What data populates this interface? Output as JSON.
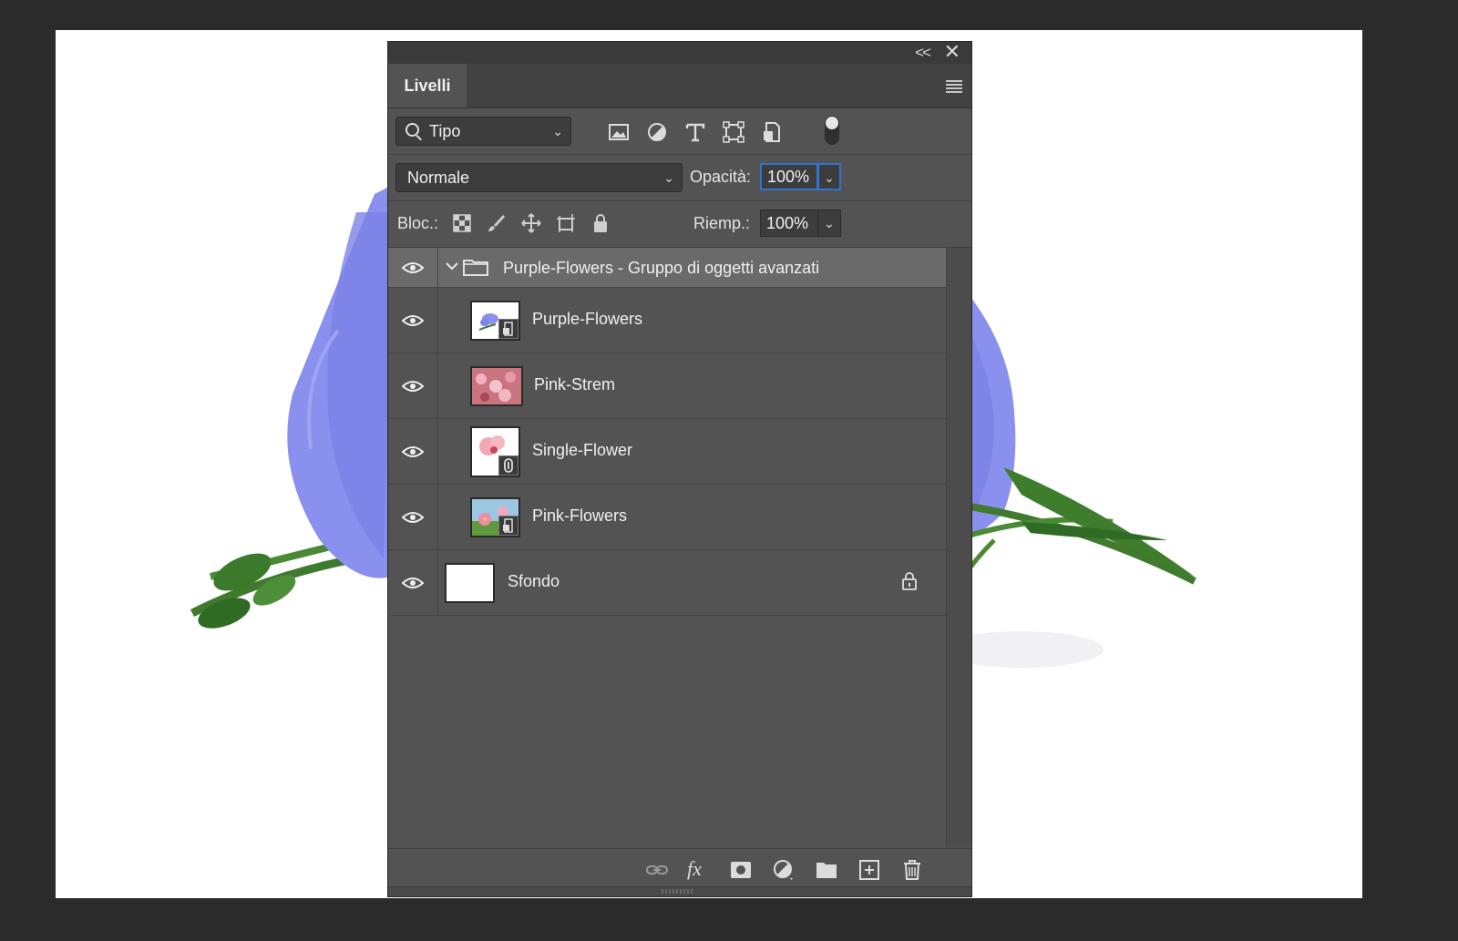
{
  "panel": {
    "tab_label": "Livelli",
    "collapse_label": "<<",
    "close_label": "✕"
  },
  "filter": {
    "kind_label": "Tipo",
    "icons": [
      "image-filter-icon",
      "adjustment-filter-icon",
      "type-filter-icon",
      "shape-filter-icon",
      "smart-object-filter-icon",
      "filter-toggle"
    ]
  },
  "blend": {
    "mode": "Normale",
    "opacity_label": "Opacità:",
    "opacity_value": "100%"
  },
  "lock": {
    "label": "Bloc.:",
    "fill_label": "Riemp.:",
    "fill_value": "100%",
    "icons": [
      "lock-transparent-pixels-icon",
      "lock-image-pixels-icon",
      "lock-position-icon",
      "lock-artboard-icon",
      "lock-all-icon"
    ]
  },
  "layers": [
    {
      "name": "Purple-Flowers - Gruppo di oggetti avanzati",
      "type": "group",
      "visible": true,
      "expanded": true
    },
    {
      "name": "Purple-Flowers",
      "type": "smart-object",
      "visible": true
    },
    {
      "name": "Pink-Strem",
      "type": "pixel",
      "visible": true
    },
    {
      "name": "Single-Flower",
      "type": "smart-object-linked",
      "visible": true
    },
    {
      "name": "Pink-Flowers",
      "type": "smart-object",
      "visible": true
    },
    {
      "name": "Sfondo",
      "type": "background",
      "visible": true,
      "locked": true
    }
  ],
  "footer_icons": [
    "link-layers-icon",
    "fx-icon",
    "layer-mask-icon",
    "adjustment-layer-icon",
    "new-group-icon",
    "new-layer-icon",
    "delete-layer-icon"
  ],
  "footer": {
    "fx_label": "fx"
  },
  "colors": {
    "app_bg": "#2b2b2b",
    "panel_bg": "#535353",
    "selected_group": "#6a6a6a",
    "focus_blue": "#2f74d0",
    "flower_purple": "#8a8ff0"
  }
}
